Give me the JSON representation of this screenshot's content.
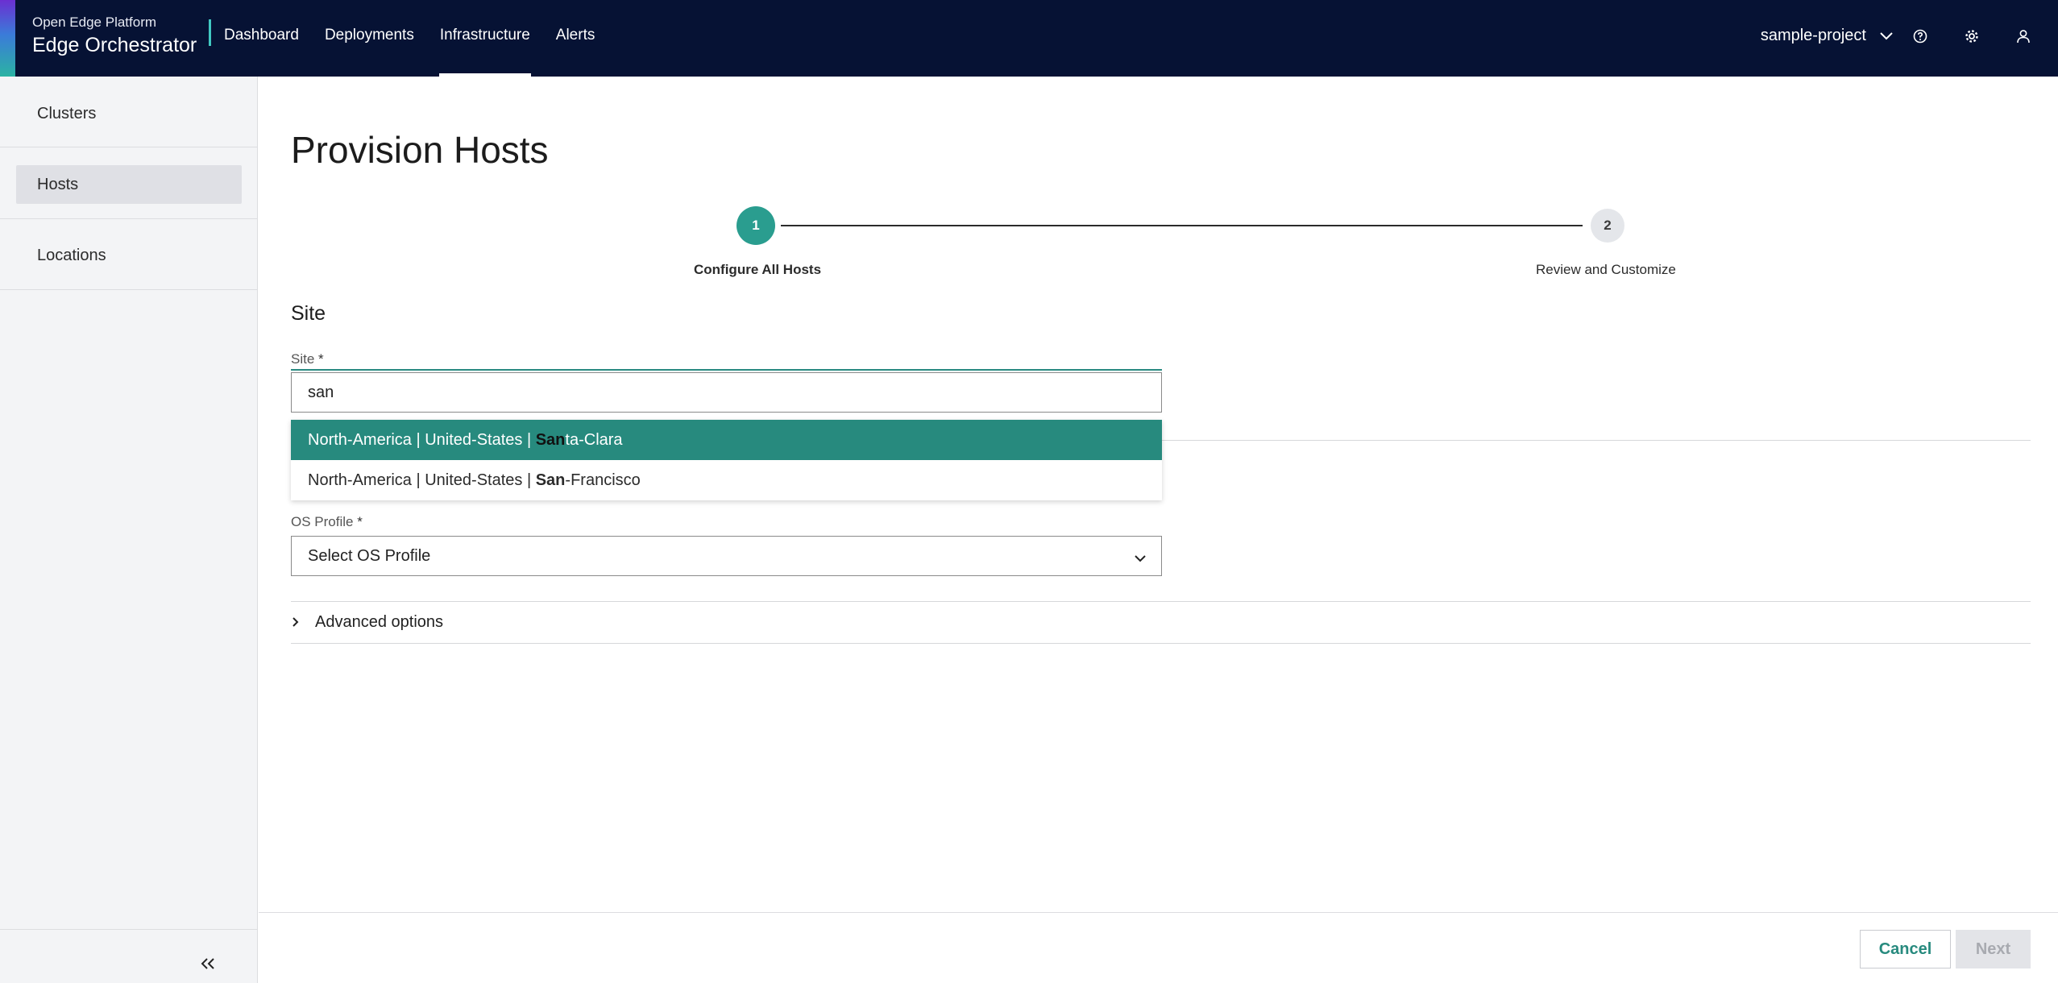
{
  "header": {
    "brand_sub": "Open Edge Platform",
    "brand_main": "Edge Orchestrator",
    "nav": [
      {
        "label": "Dashboard",
        "active": false
      },
      {
        "label": "Deployments",
        "active": false
      },
      {
        "label": "Infrastructure",
        "active": true
      },
      {
        "label": "Alerts",
        "active": false
      }
    ],
    "project": "sample-project",
    "icons": [
      "chevron-down-icon",
      "help-icon",
      "gear-icon",
      "user-icon"
    ]
  },
  "sidebar": {
    "items": [
      {
        "label": "Clusters",
        "active": false
      },
      {
        "label": "Hosts",
        "active": true
      },
      {
        "label": "Locations",
        "active": false
      }
    ],
    "collapse_icon": "double-chevron-left-icon"
  },
  "main": {
    "title": "Provision Hosts",
    "stepper": {
      "steps": [
        {
          "number": "1",
          "label": "Configure All Hosts",
          "active": true
        },
        {
          "number": "2",
          "label": "Review and Customize",
          "active": false
        }
      ]
    },
    "section_title": "Site",
    "site_field": {
      "label": "Site",
      "required_mark": "*",
      "value": "san"
    },
    "site_options": [
      {
        "prefix": "North-America | United-States | ",
        "match": "San",
        "suffix": "ta-Clara",
        "highlighted": true
      },
      {
        "prefix": "North-America | United-States | ",
        "match": "San",
        "suffix": "-Francisco",
        "highlighted": false
      }
    ],
    "os_field": {
      "label": "OS Profile",
      "required_mark": "*",
      "value": "Select OS Profile"
    },
    "advanced_label": "Advanced options"
  },
  "footer": {
    "cancel_label": "Cancel",
    "next_label": "Next",
    "next_disabled": true
  },
  "colors": {
    "header_bg": "#061234",
    "accent": "#2a9d8f",
    "highlight_option": "#278a7e"
  }
}
